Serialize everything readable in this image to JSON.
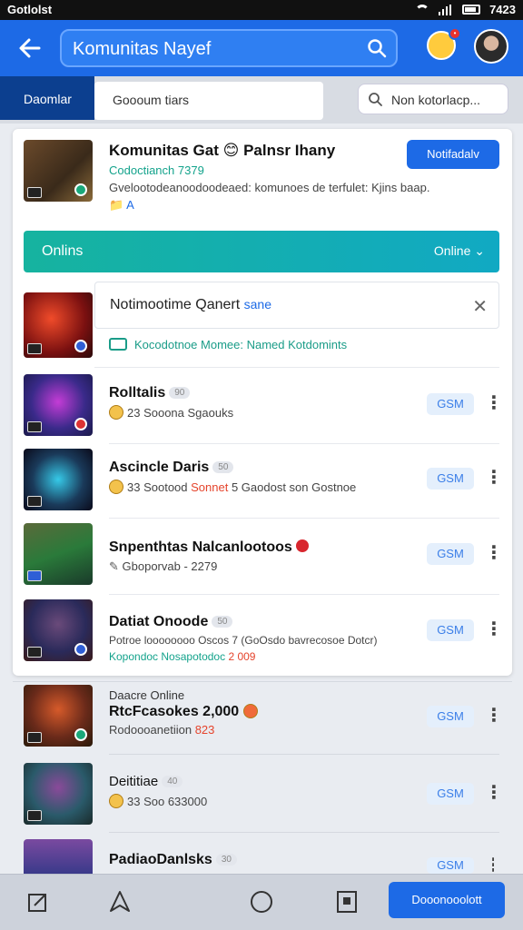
{
  "status_bar": {
    "carrier": "Gotlolst",
    "time": "7423"
  },
  "app_bar": {
    "search_value": "Komunitas Nayef"
  },
  "tabs": {
    "active": "Daomlar",
    "middle": "Goooum tiars",
    "search_placeholder": "Non kotorlacp..."
  },
  "hero": {
    "title": "Komunitas Gat 😊 Palnsr Ihany",
    "subtitle": "Codoctianch 7379",
    "description": "Gvelootodeanoodoodeaed: komunoes de terfulet: Kjins baap.",
    "tags": "📁 A",
    "follow_label": "Notifadalv"
  },
  "online_bar": {
    "left": "Onlins",
    "right": "Online ⌄"
  },
  "notice": {
    "text": "Notimootime Qanert",
    "highlight": "sane",
    "close": "✕"
  },
  "named_text": "Kocodotnoe Momee: Named Kotdomints",
  "rows_in_card": [
    {
      "name": "Rolltalis",
      "pill": "90",
      "meta": "23 Sooona Sgaouks",
      "size": "GSM"
    },
    {
      "name": "Ascincle Daris",
      "pill": "50",
      "meta_a": "33 Sootood ",
      "meta_red": "Sonnet",
      "meta_b": " 5 Gaodost son Gostnoe",
      "size": "GSM"
    },
    {
      "name": "Snpenthtas Nalcanlootoos",
      "meta": "Gboporvab - 2279",
      "size": "GSM"
    },
    {
      "name": "Datiat Onoode",
      "pill": "50",
      "meta": "Potroe loooooooo Oscos 7 (GoOsdo bavrecosoe Dotcr)",
      "meta2": "Kopondoc  Nosapotodoc",
      "meta2_red": "2 009",
      "size": "GSM"
    }
  ],
  "rows_outside": [
    {
      "top": "Daacre Online",
      "name": "RtcFcasokes 2,000",
      "meta_a": "Rodoooanetiion ",
      "meta_red": "823",
      "size": "GSM"
    },
    {
      "name": "Deititiae",
      "pill": "40",
      "meta": "33 Soo 633000",
      "size": "GSM"
    },
    {
      "name": "PadiaoDanlsks",
      "pill": "30",
      "size": "GSM"
    }
  ],
  "bottom_nav": {
    "cta": "Dooonooolott"
  },
  "colors": {
    "primary": "#1d6ae6",
    "teal": "#14a38c",
    "accent_red": "#e5442c"
  }
}
